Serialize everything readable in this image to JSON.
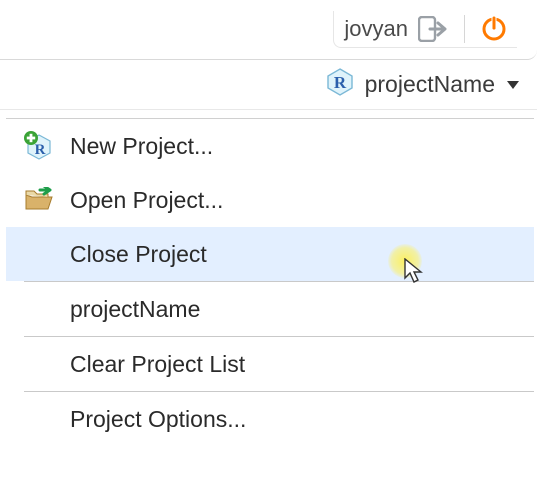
{
  "topbar": {
    "username": "jovyan"
  },
  "projbar": {
    "project_label": "projectName"
  },
  "menu": {
    "items": [
      {
        "label": "New Project...",
        "icon": "new-project-icon"
      },
      {
        "label": "Open Project...",
        "icon": "open-folder-icon"
      },
      {
        "label": "Close Project",
        "highlighted": true
      },
      {
        "label": "projectName"
      },
      {
        "label": "Clear Project List"
      },
      {
        "label": "Project Options..."
      }
    ]
  }
}
